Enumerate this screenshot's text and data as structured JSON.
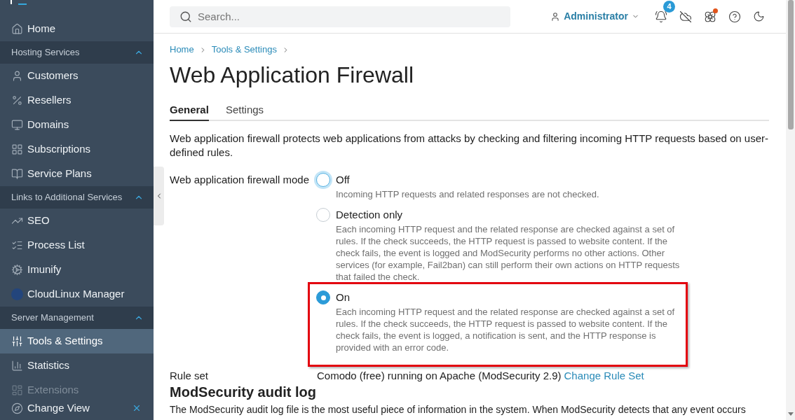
{
  "sidebar": {
    "home": {
      "label": "Home",
      "selected": false
    },
    "sections": [
      {
        "label": "Hosting Services",
        "expanded": true,
        "items": [
          {
            "label": "Customers",
            "selected": false
          },
          {
            "label": "Resellers",
            "selected": false
          },
          {
            "label": "Domains",
            "selected": false
          },
          {
            "label": "Subscriptions",
            "selected": false
          },
          {
            "label": "Service Plans",
            "selected": false
          }
        ]
      },
      {
        "label": "Links to Additional Services",
        "expanded": true,
        "items": [
          {
            "label": "SEO",
            "selected": false
          },
          {
            "label": "Process List",
            "selected": false
          },
          {
            "label": "Imunify",
            "selected": false
          },
          {
            "label": "CloudLinux Manager",
            "selected": false
          }
        ]
      },
      {
        "label": "Server Management",
        "expanded": true,
        "items": [
          {
            "label": "Tools & Settings",
            "selected": true
          },
          {
            "label": "Statistics",
            "selected": false
          },
          {
            "label": "Extensions",
            "selected": false
          }
        ]
      }
    ],
    "footer": {
      "label": "Change View"
    }
  },
  "topbar": {
    "search": {
      "placeholder": "Search..."
    },
    "user": {
      "name": "Administrator"
    },
    "notifications": {
      "count": "4"
    },
    "status_icon": {
      "dot": true
    }
  },
  "breadcrumb": [
    "Home",
    "Tools & Settings"
  ],
  "title": "Web Application Firewall",
  "tabs": [
    {
      "label": "General",
      "selected": true
    },
    {
      "label": "Settings",
      "selected": false
    }
  ],
  "description": "Web application firewall protects web applications from attacks by checking and filtering incoming HTTP requests based on user-defined rules.",
  "mode": {
    "label": "Web application firewall mode",
    "options": [
      {
        "label": "Off",
        "description": "Incoming HTTP requests and related responses are not checked.",
        "selected": false,
        "focused": true,
        "highlighted": false
      },
      {
        "label": "Detection only",
        "description": "Each incoming HTTP request and the related response are checked against a set of rules. If the check succeeds, the HTTP request is passed to website content. If the check fails, the event is logged and ModSecurity performs no other actions. Other services (for example, Fail2ban) can still perform their own actions on HTTP requests that failed the check.",
        "selected": false,
        "focused": false,
        "highlighted": false
      },
      {
        "label": "On",
        "description": "Each incoming HTTP request and the related response are checked against a set of rules. If the check succeeds, the HTTP request is passed to website content. If the check fails, the event is logged, a notification is sent, and the HTTP response is provided with an error code.",
        "selected": true,
        "focused": false,
        "highlighted": true
      }
    ]
  },
  "rule_set": {
    "label": "Rule set",
    "value": "Comodo (free) running on Apache (ModSecurity 2.9)",
    "link": "Change Rule Set"
  },
  "audit_log": {
    "heading": "ModSecurity audit log",
    "text": "The ModSecurity audit log file is the most useful piece of information in the system. When ModSecurity detects that any event occurs"
  }
}
